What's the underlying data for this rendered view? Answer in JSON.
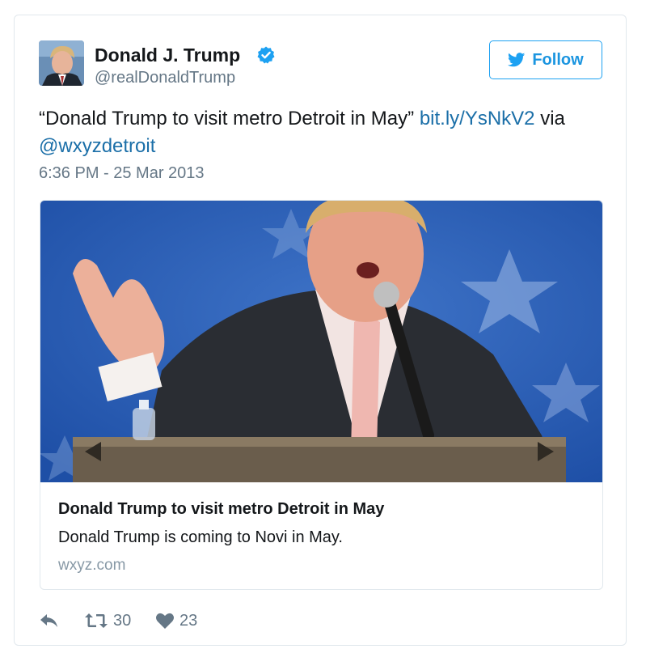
{
  "tweet": {
    "author": {
      "name": "Donald J. Trump",
      "handle": "@realDonaldTrump",
      "verified": true
    },
    "follow_label": "Follow",
    "text_before": "“Donald Trump to visit metro Detroit in May” ",
    "link": "bit.ly/YsNkV2",
    "text_middle": " via ",
    "mention": "@wxyzdetroit",
    "timestamp": "6:36 PM - 25 Mar 2013",
    "card": {
      "title": "Donald Trump to visit metro Detroit in May",
      "description": "Donald Trump is coming to Novi in May.",
      "domain": "wxyz.com"
    },
    "actions": {
      "retweet_count": "30",
      "like_count": "23"
    }
  },
  "icons": {
    "verified": "verified-badge-icon",
    "follow": "twitter-bird-icon",
    "reply": "reply-icon",
    "retweet": "retweet-icon",
    "like": "heart-icon"
  },
  "colors": {
    "link": "#1b6fa8",
    "follow_blue": "#1da1f2",
    "muted": "#657786",
    "border": "#e1e8ed"
  }
}
